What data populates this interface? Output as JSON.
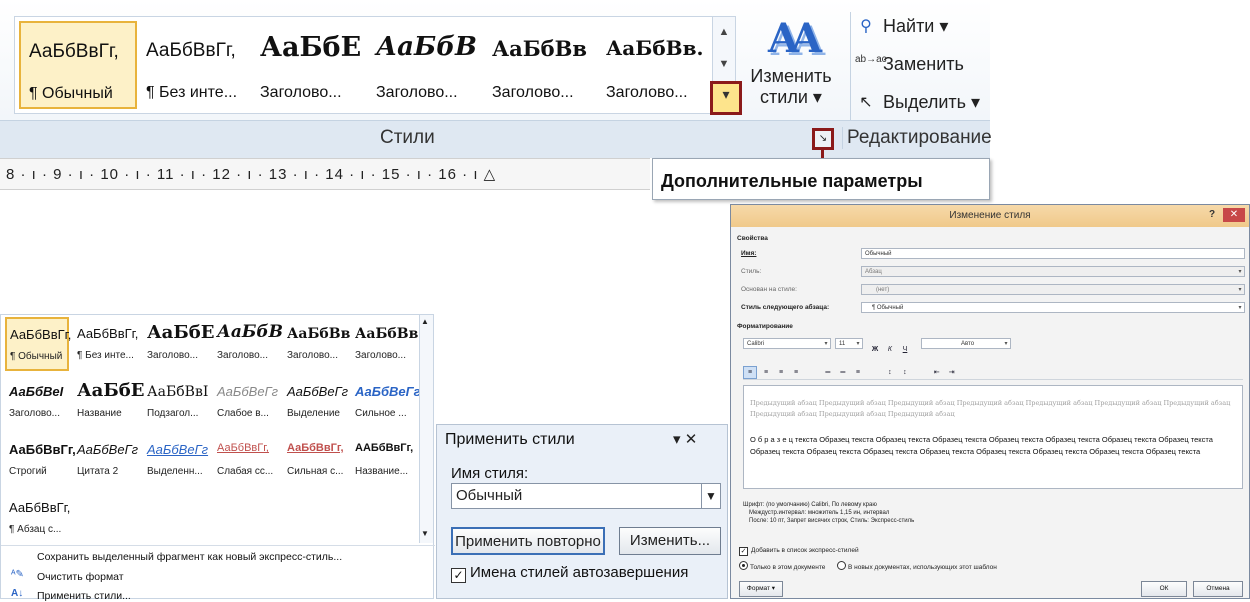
{
  "ribbon": {
    "gallery_items": [
      {
        "sample": "АаБбВвГг,",
        "name": "¶ Обычный",
        "selected": true
      },
      {
        "sample": "АаБбВвГг,",
        "name": "¶ Без инте..."
      },
      {
        "sample": "АаБбЕ",
        "name": "Заголово..."
      },
      {
        "sample": "АаБбВ",
        "name": "Заголово..."
      },
      {
        "sample": "АаБбВв",
        "name": "Заголово..."
      },
      {
        "sample": "АаБбВв.",
        "name": "Заголово..."
      }
    ],
    "change_styles": {
      "icon_text": "AA",
      "label_line1": "Изменить",
      "label_line2": "стили ▾"
    },
    "editing": {
      "find": "Найти ▾",
      "replace": "Заменить",
      "replace_icon": "ab→ac",
      "select": "Выделить ▾"
    },
    "group_styles": "Стили",
    "group_editing": "Редактирование",
    "ruler": "8 · ı · 9 · ı · 10 · ı · 11 · ı · 12 · ı · 13 · ı · 14 · ı · 15 · ı · 16 · ı △",
    "tooltip": "Дополнительные параметры"
  },
  "styles_panel": {
    "rows": [
      [
        {
          "sample": "АаБбВвГг,",
          "name": "¶ Обычный",
          "selected": true
        },
        {
          "sample": "АаБбВвГг,",
          "name": "¶ Без инте..."
        },
        {
          "sample": "АаБбЕ",
          "name": "Заголово..."
        },
        {
          "sample": "АаБбВ",
          "name": "Заголово..."
        },
        {
          "sample": "АаБбВв",
          "name": "Заголово..."
        },
        {
          "sample": "АаБбВв",
          "name": "Заголово..."
        }
      ],
      [
        {
          "sample": "АаБбВеІ",
          "name": "Заголово..."
        },
        {
          "sample": "АаБбЕ",
          "name": "Название"
        },
        {
          "sample": "АаБбВвІ",
          "name": "Подзагол..."
        },
        {
          "sample": "АаБбВеГг",
          "name": "Слабое в..."
        },
        {
          "sample": "АаБбВеГг",
          "name": "Выделение"
        },
        {
          "sample": "АаБбВеГг",
          "name": "Сильное ..."
        }
      ],
      [
        {
          "sample": "АаБбВвГг,",
          "name": "Строгий"
        },
        {
          "sample": "АаБбВеГг",
          "name": "Цитата 2"
        },
        {
          "sample": "АаБбВеГг",
          "name": "Выделенн..."
        },
        {
          "sample": "АаБбВвГг,",
          "name": "Слабая сс..."
        },
        {
          "sample": "АаБбВвГг,",
          "name": "Сильная с..."
        },
        {
          "sample": "ААБбВвГг,",
          "name": "Название..."
        }
      ],
      [
        {
          "sample": "АаБбВвГг,",
          "name": "¶ Абзац с..."
        }
      ]
    ],
    "menu": [
      "Сохранить выделенный фрагмент как новый экспресс-стиль...",
      "Очистить формат",
      "Применить стили..."
    ]
  },
  "apply_pane": {
    "title": "Применить стили",
    "controls": "▾ ✕",
    "label": "Имя стиля:",
    "value": "Обычный",
    "btn_reapply": "Применить повторно",
    "btn_modify": "Изменить...",
    "autocomplete": "Имена стилей автозавершения"
  },
  "dialog": {
    "title": "Изменение стиля",
    "help": "?",
    "close": "✕",
    "section_props": "Свойства",
    "name_label": "Имя:",
    "name_value": "Обычный",
    "type_label": "Стиль:",
    "type_value": "Абзац",
    "based_label": "Основан на стиле:",
    "based_value": "(нет)",
    "next_label": "Стиль следующего абзаца:",
    "next_value": "¶ Обычный",
    "section_format": "Форматирование",
    "font": "Calibri",
    "size": "11",
    "color": "Авто",
    "preview_prev": "Предыдущий абзац Предыдущий абзац Предыдущий абзац Предыдущий абзац Предыдущий абзац Предыдущий абзац Предыдущий абзац Предыдущий абзац Предыдущий абзац Предыдущий абзац",
    "preview_sample": "О б р а з е ц текста Образец текста Образец текста Образец текста Образец текста Образец текста Образец текста Образец текста Образец текста Образец текста Образец текста Образец текста Образец текста Образец текста Образец текста Образец текста",
    "desc_line1": "Шрифт: (по умолчанию) Calibri, По левому краю",
    "desc_line2": "Междустр.интервал: множитель 1,15 ин, интервал",
    "desc_line3": "После: 10 пт, Запрет висячих строк, Стиль: Экспресс-стиль",
    "add_to_gallery": "Добавить в список экспресс-стилей",
    "only_doc": "Только в этом документе",
    "new_docs": "В новых документах, использующих этот шаблон",
    "format_btn": "Формат ▾",
    "ok": "ОК",
    "cancel": "Отмена"
  }
}
